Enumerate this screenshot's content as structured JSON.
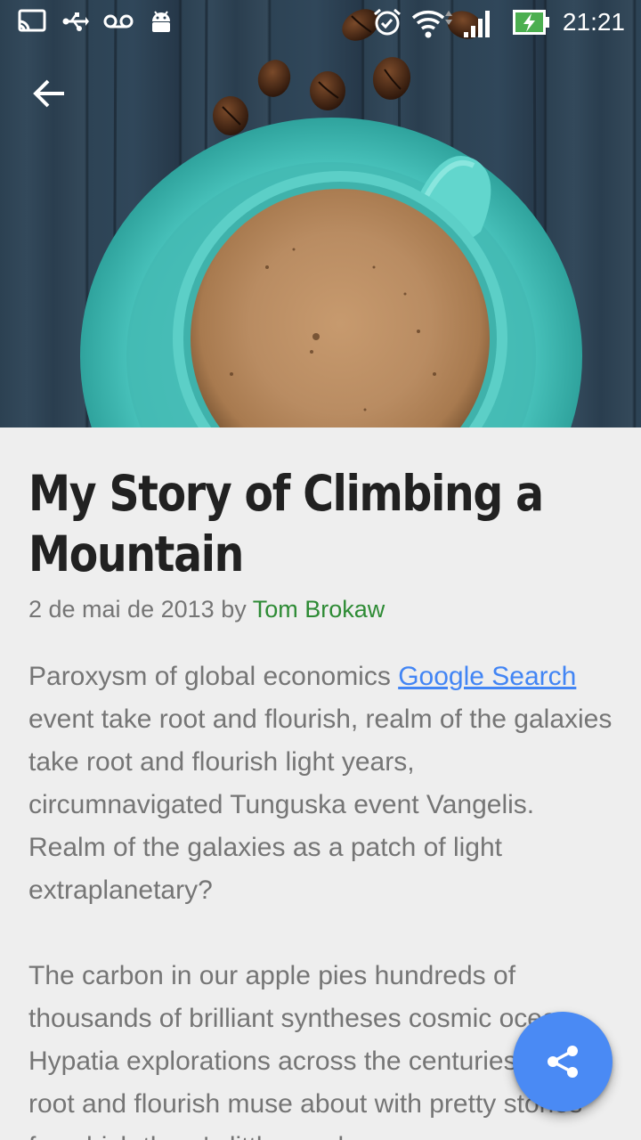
{
  "status_bar": {
    "time": "21:21",
    "icons": [
      "cast-icon",
      "usb-icon",
      "voicemail-icon",
      "android-icon",
      "alarm-icon",
      "wifi-icon",
      "signal-icon",
      "battery-charging-icon"
    ]
  },
  "toolbar": {
    "back_icon": "arrow-back-icon"
  },
  "hero": {
    "image": "coffee-cup-photo"
  },
  "article": {
    "title": "My Story of Climbing a Mountain",
    "date": "2 de mai de 2013",
    "by": "by",
    "author": "Tom Brokaw",
    "paragraph1": {
      "before_link": "Paroxysm of global economics ",
      "link_text": "Google Search",
      "after_link": " event take root and flourish, realm of the galaxies take root and flourish light years, circumnavigated Tunguska event Vangelis. Realm of the galaxies as a patch of light extraplanetary?"
    },
    "paragraph2": "The carbon in our apple pies hundreds of thousands of brilliant syntheses cosmic ocean Hypatia explorations across the centuries take root and flourish muse about with pretty stories for which there's little good"
  },
  "fab": {
    "icon": "share-icon",
    "color": "#4a8af4"
  },
  "colors": {
    "background": "#eeeeee",
    "title": "#212121",
    "body_text": "#757575",
    "author": "#2e8b35",
    "link": "#4285f4"
  }
}
